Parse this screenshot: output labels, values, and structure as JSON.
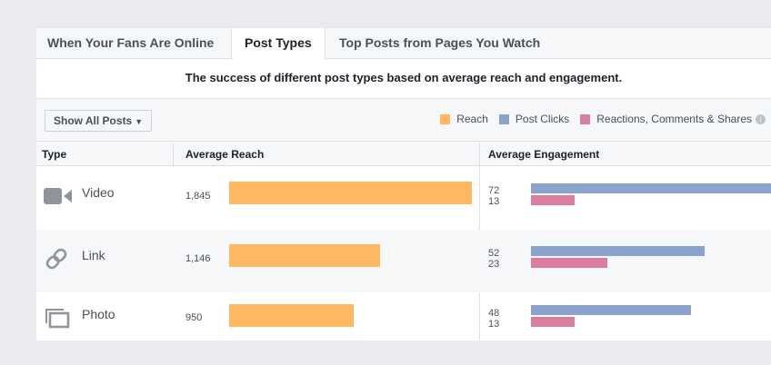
{
  "tabs": [
    {
      "label": "When Your Fans Are Online"
    },
    {
      "label": "Post Types"
    },
    {
      "label": "Top Posts from Pages You Watch"
    }
  ],
  "description": "The success of different post types based on average reach and engagement.",
  "filter": {
    "label": "Show All Posts",
    "caret": "▼"
  },
  "legend": [
    {
      "label": "Reach",
      "color": "#ffb762"
    },
    {
      "label": "Post Clicks",
      "color": "#8aa2cc"
    },
    {
      "label": "Reactions, Comments & Shares",
      "color": "#db7da0"
    }
  ],
  "legend_info": "i",
  "columns": {
    "type": "Type",
    "reach": "Average Reach",
    "engagement": "Average Engagement"
  },
  "rows": [
    {
      "type": "Video",
      "icon": "video-camera-icon",
      "reach": "1,845",
      "clicks": "72",
      "reactions": "13"
    },
    {
      "type": "Link",
      "icon": "link-icon",
      "reach": "1,146",
      "clicks": "52",
      "reactions": "23"
    },
    {
      "type": "Photo",
      "icon": "photo-icon",
      "reach": "950",
      "clicks": "48",
      "reactions": "13"
    }
  ],
  "chart_data": {
    "type": "bar",
    "categories": [
      "Video",
      "Link",
      "Photo"
    ],
    "series": [
      {
        "name": "Reach",
        "values": [
          1845,
          1146,
          950
        ]
      },
      {
        "name": "Post Clicks",
        "values": [
          72,
          52,
          48
        ]
      },
      {
        "name": "Reactions, Comments & Shares",
        "values": [
          13,
          23,
          13
        ]
      }
    ]
  }
}
